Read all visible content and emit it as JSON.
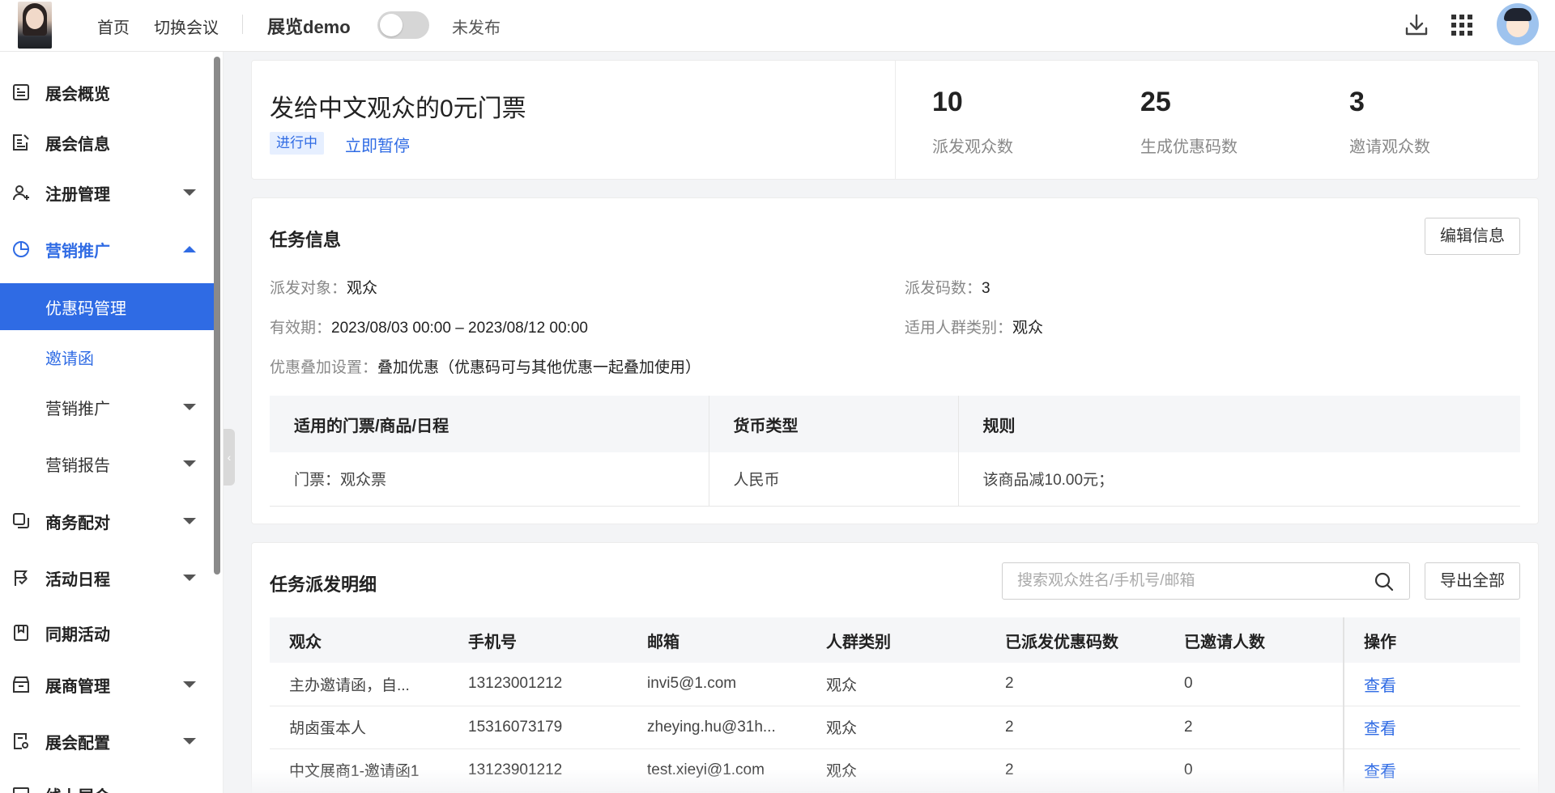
{
  "topbar": {
    "nav": [
      "首页",
      "切换会议"
    ],
    "expo_name": "展览demo",
    "publish_toggle": false,
    "publish_status": "未发布",
    "icons": [
      "download-icon",
      "apps-grid-icon"
    ]
  },
  "sidebar": {
    "items": [
      {
        "label": "展会概览",
        "icon": "overview-icon"
      },
      {
        "label": "展会信息",
        "icon": "edit-doc-icon"
      },
      {
        "label": "注册管理",
        "icon": "user-add-icon"
      },
      {
        "label": "营销推广",
        "icon": "pie-chart-icon"
      },
      {
        "label": "商务配对",
        "icon": "copy-icon"
      },
      {
        "label": "活动日程",
        "icon": "flag-icon"
      },
      {
        "label": "同期活动",
        "icon": "bookmark-icon"
      },
      {
        "label": "展商管理",
        "icon": "store-icon"
      },
      {
        "label": "展会配置",
        "icon": "settings-doc-icon"
      },
      {
        "label": "线上展会",
        "icon": "monitor-icon"
      }
    ],
    "sub_items": [
      "优惠码管理",
      "邀请函",
      "营销推广",
      "营销报告"
    ]
  },
  "summary": {
    "title": "发给中文观众的0元门票",
    "status_badge": "进行中",
    "pause_link": "立即暂停",
    "stats": [
      {
        "value": "10",
        "label": "派发观众数"
      },
      {
        "value": "25",
        "label": "生成优惠码数"
      },
      {
        "value": "3",
        "label": "邀请观众数"
      }
    ]
  },
  "task": {
    "title": "任务信息",
    "edit_button": "编辑信息",
    "target_label": "派发对象：",
    "target_value": "观众",
    "code_count_label": "派发码数：",
    "code_count_value": "3",
    "validity_label": "有效期：",
    "validity_value": "2023/08/03 00:00 – 2023/08/12 00:00",
    "audience_type_label": "适用人群类别：",
    "audience_type_value": "观众",
    "stacking_label": "优惠叠加设置：",
    "stacking_value": "叠加优惠（优惠码可与其他优惠一起叠加使用）",
    "rule_table": {
      "headers": [
        "适用的门票/商品/日程",
        "货币类型",
        "规则"
      ],
      "rows": [
        [
          "门票：观众票",
          "人民币",
          "该商品减10.00元；"
        ]
      ]
    }
  },
  "detail": {
    "title": "任务派发明细",
    "search_placeholder": "搜索观众姓名/手机号/邮箱",
    "export_button": "导出全部",
    "headers": [
      "观众",
      "手机号",
      "邮箱",
      "人群类别",
      "已派发优惠码数",
      "已邀请人数",
      "操作"
    ],
    "rows": [
      [
        "主办邀请函，自...",
        "13123001212",
        "invi5@1.com",
        "观众",
        "2",
        "0",
        "查看"
      ],
      [
        "胡卤蛋本人",
        "15316073179",
        "zheying.hu@31h...",
        "观众",
        "2",
        "2",
        "查看"
      ],
      [
        "中文展商1-邀请函1",
        "13123901212",
        "test.xieyi@1.com",
        "观众",
        "2",
        "0",
        "查看"
      ]
    ]
  },
  "colors": {
    "accent": "#2f6be4",
    "badge_bg": "#e6efff"
  }
}
